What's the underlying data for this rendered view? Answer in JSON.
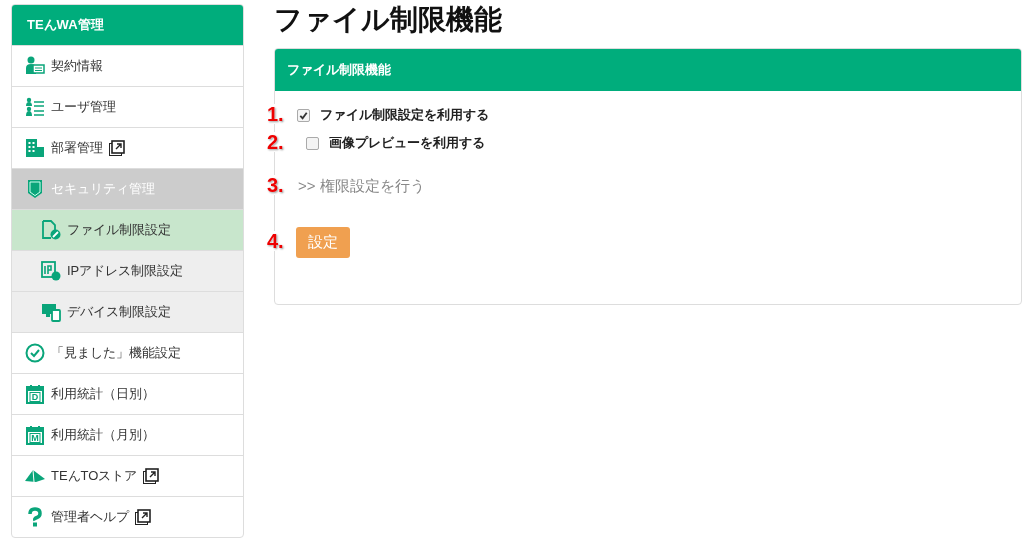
{
  "sidebar": {
    "title": "TEんWA管理",
    "items": [
      {
        "label": "契約情報",
        "kind": "contract",
        "external": false,
        "selected": false
      },
      {
        "label": "ユーザ管理",
        "kind": "users",
        "external": false,
        "selected": false
      },
      {
        "label": "部署管理",
        "kind": "building",
        "external": true,
        "selected": false
      },
      {
        "label": "セキュリティ管理",
        "kind": "shield",
        "external": false,
        "selected": false,
        "expanded": true,
        "children": [
          {
            "label": "ファイル制限設定",
            "kind": "file",
            "selected": true
          },
          {
            "label": "IPアドレス制限設定",
            "kind": "ip",
            "selected": false
          },
          {
            "label": "デバイス制限設定",
            "kind": "device",
            "selected": false
          }
        ]
      },
      {
        "label": "「見ました」機能設定",
        "kind": "check",
        "external": false,
        "selected": false
      },
      {
        "label": "利用統計（日別）",
        "kind": "calendar",
        "mark": "D",
        "external": false,
        "selected": false
      },
      {
        "label": "利用統計（月別）",
        "kind": "calendar",
        "mark": "M",
        "external": false,
        "selected": false
      },
      {
        "label": "TEんTOストア",
        "kind": "tent",
        "external": true,
        "selected": false
      },
      {
        "label": "管理者ヘルプ",
        "kind": "help",
        "external": true,
        "selected": false
      }
    ]
  },
  "page_title": "ファイル制限機能",
  "panel": {
    "title": "ファイル制限機能",
    "rows": [
      {
        "number": "1.",
        "kind": "checkbox",
        "label": "ファイル制限設定を利用する",
        "checked": true
      },
      {
        "number": "2.",
        "kind": "checkbox",
        "label": "画像プレビューを利用する",
        "checked": false
      },
      {
        "number": "3.",
        "kind": "link",
        "label": ">> 権限設定を行う"
      },
      {
        "number": "4.",
        "kind": "button",
        "label": "設定"
      }
    ]
  }
}
